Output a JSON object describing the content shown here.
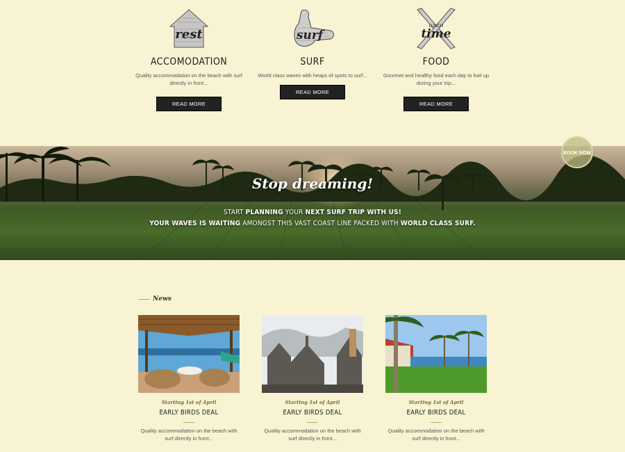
{
  "features": [
    {
      "icon": "house-rest-icon",
      "icon_text": "rest",
      "title": "ACCOMODATION",
      "text": "Quality accommodation on the beach with surf directly in front...",
      "button": "READ MORE"
    },
    {
      "icon": "shaka-surf-icon",
      "icon_text": "surf",
      "title": "SURF",
      "text": "World class waves with heaps of spots to surf...",
      "button": "READ MORE"
    },
    {
      "icon": "cutlery-lunch-icon",
      "icon_text_small": "LUNCH",
      "icon_text": "time",
      "title": "FOOD",
      "text": "Gourmet and healthy food each day to fuel up during your trip...",
      "button": "READ MORE"
    }
  ],
  "banner": {
    "title": "Stop dreaming!",
    "line1": {
      "a": "START ",
      "b": "PLANNING",
      "c": " YOUR ",
      "d": "NEXT SURF TRIP WITH US!"
    },
    "line2": {
      "a": "YOUR WAVES IS WAITING",
      "b": " AMONGST THIS VAST COAST LINE PACKED WITH ",
      "c": "WORLD CLASS SURF."
    },
    "book_now": "BOOK NOW"
  },
  "news": {
    "heading": "News",
    "items": [
      {
        "image": "bali-hut-lounge-photo",
        "date": "Starting 1st of April",
        "title": "EARLY BIRDS DEAL",
        "text": "Quality accommodation on the beach with surf directly in front..."
      },
      {
        "image": "temple-stupas-photo",
        "date": "Starting 1st of April",
        "title": "EARLY BIRDS DEAL",
        "text": "Quality accommodation on the beach with surf directly in front..."
      },
      {
        "image": "beach-bungalow-palms-photo",
        "date": "Starting 1st of April",
        "title": "EARLY BIRDS DEAL",
        "text": "Quality accommodation on the beach with surf directly in front..."
      }
    ]
  }
}
